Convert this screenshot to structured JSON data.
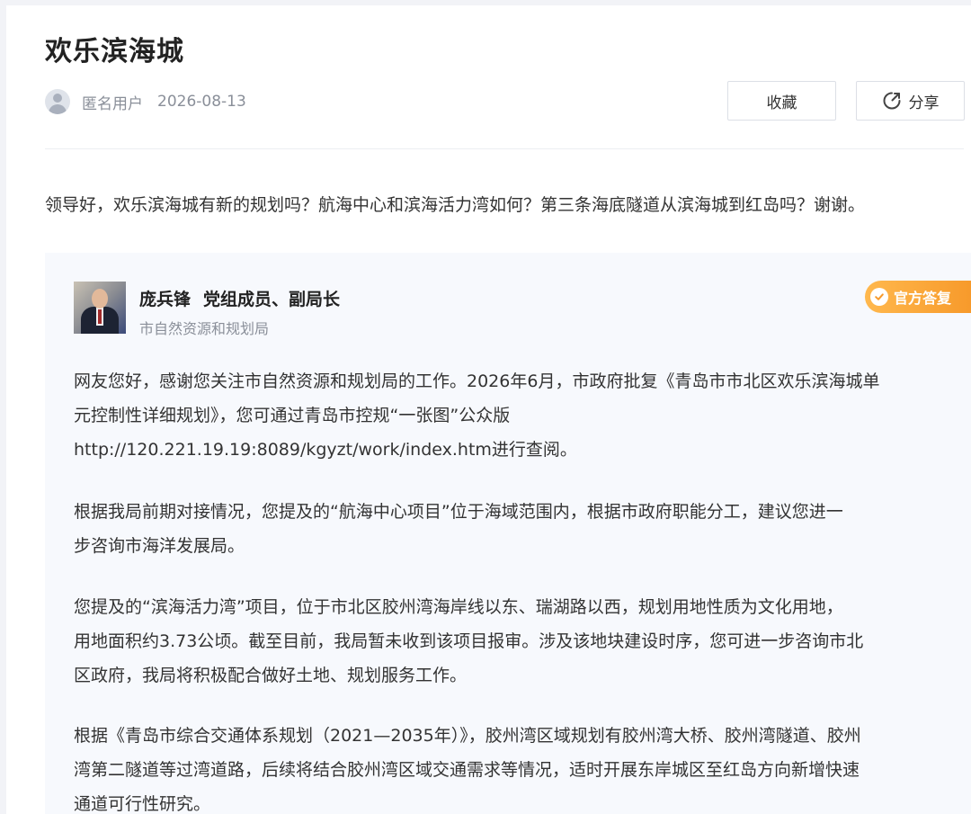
{
  "article": {
    "title": "欢乐滨海城",
    "author": "匿名用户",
    "date": "2026-08-13",
    "question": "领导好，欢乐滨海城有新的规划吗？航海中心和滨海活力湾如何？第三条海底隧道从滨海城到红岛吗？谢谢。"
  },
  "actions": {
    "collect_label": "收藏",
    "share_label": "分享",
    "share_icon": "share-icon"
  },
  "answer": {
    "official_name": "庞兵锋",
    "official_role": "党组成员、副局长",
    "department": "市自然资源和规划局",
    "badge_label": "官方答复",
    "badge_icon": "check-circle-icon",
    "accent_color": "#f79a2b",
    "paragraphs": [
      {
        "lines": [
          "网友您好，感谢您关注市自然资源和规划局的工作。2026年6月，市政府批复《青岛市市北区欢乐滨海城单",
          "元控制性详细规划》，您可通过青岛市控规“一张图”公众版",
          "http://120.221.19.19:8089/kgyzt/work/index.htm进行查阅。"
        ]
      },
      {
        "lines": [
          "根据我局前期对接情况，您提及的“航海中心项目”位于海域范围内，根据市政府职能分工，建议您进一",
          "步咨询市海洋发展局。"
        ]
      },
      {
        "lines": [
          "您提及的“滨海活力湾”项目，位于市北区胶州湾海岸线以东、瑞湖路以西，规划用地性质为文化用地，",
          "用地面积约3.73公顷。截至目前，我局暂未收到该项目报审。涉及该地块建设时序，您可进一步咨询市北",
          "区政府，我局将积极配合做好土地、规划服务工作。"
        ]
      },
      {
        "lines": [
          "根据《青岛市综合交通体系规划（2021—2035年）》，胶州湾区域规划有胶州湾大桥、胶州湾隧道、胶州",
          "湾第二隧道等过湾道路，后续将结合胶州湾区域交通需求等情况，适时开展东岸城区至红岛方向新增快速",
          "通道可行性研究。"
        ]
      }
    ]
  }
}
